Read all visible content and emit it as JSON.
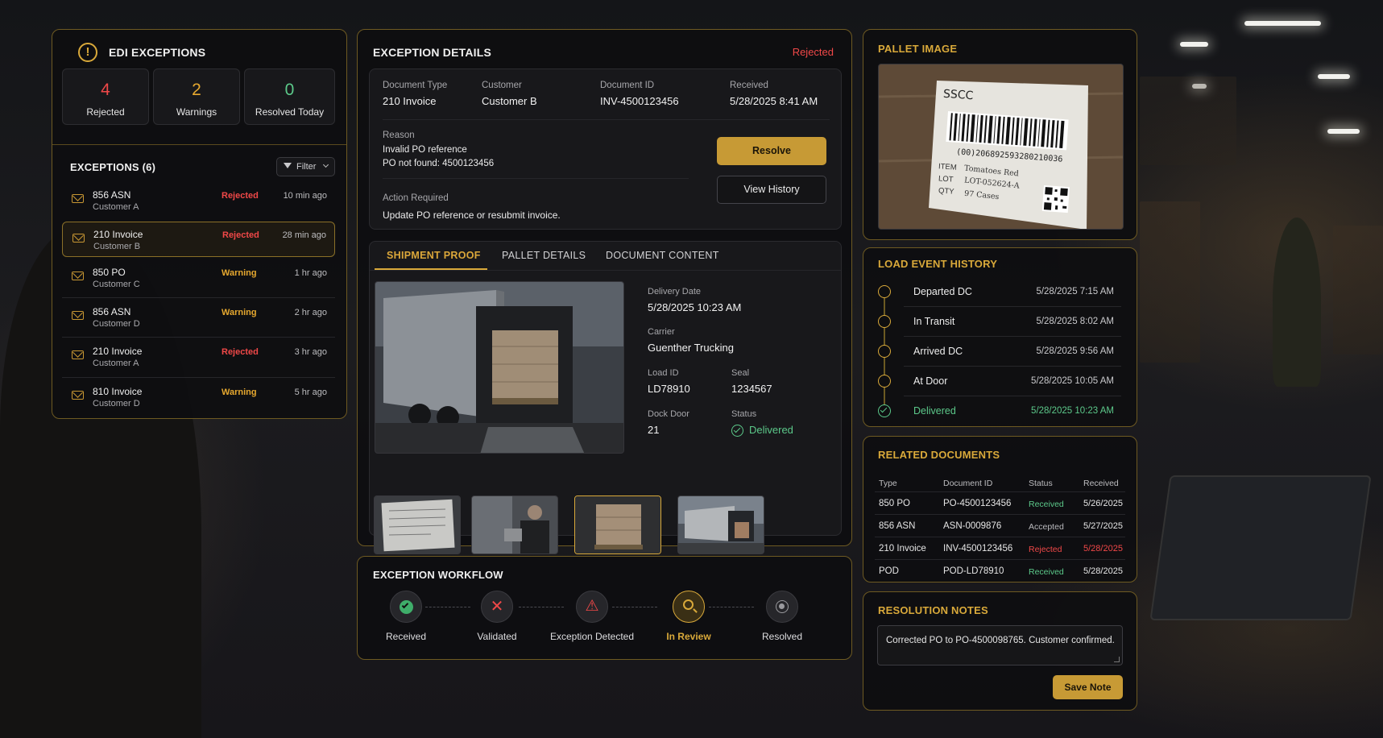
{
  "edi": {
    "title": "EDI EXCEPTIONS",
    "stats": [
      {
        "num": "4",
        "label": "Rejected",
        "color": "#f04848"
      },
      {
        "num": "2",
        "label": "Warnings",
        "color": "#e6a82f"
      },
      {
        "num": "0",
        "label": "Resolved Today",
        "color": "#5cc98a"
      }
    ],
    "list_title": "EXCEPTIONS (6)",
    "filter_label": "Filter",
    "items": [
      {
        "type": "856 ASN",
        "customer": "Customer A",
        "status": "Rejected",
        "time": "10 min ago"
      },
      {
        "type": "210 Invoice",
        "customer": "Customer B",
        "status": "Rejected",
        "time": "28 min ago"
      },
      {
        "type": "850 PO",
        "customer": "Customer C",
        "status": "Warning",
        "time": "1 hr ago"
      },
      {
        "type": "856 ASN",
        "customer": "Customer D",
        "status": "Warning",
        "time": "2 hr ago"
      },
      {
        "type": "210 Invoice",
        "customer": "Customer A",
        "status": "Rejected",
        "time": "3 hr ago"
      },
      {
        "type": "810 Invoice",
        "customer": "Customer D",
        "status": "Warning",
        "time": "5 hr ago"
      }
    ]
  },
  "details": {
    "title": "EXCEPTION DETAILS",
    "status": "Rejected",
    "doc_type_label": "Document Type",
    "doc_type": "210 Invoice",
    "customer_label": "Customer",
    "customer": "Customer B",
    "doc_id_label": "Document ID",
    "doc_id": "INV-4500123456",
    "received_label": "Received",
    "received": "5/28/2025 8:41 AM",
    "reason_label": "Reason",
    "reason_line1": "Invalid PO reference",
    "reason_line2": "PO not found: 4500123456",
    "action_label": "Action Required",
    "action": "Update PO reference or resubmit invoice.",
    "resolve_label": "Resolve",
    "history_label": "View History"
  },
  "tabs": [
    "SHIPMENT PROOF",
    "PALLET DETAILS",
    "DOCUMENT CONTENT"
  ],
  "shipment": {
    "delivery_date_label": "Delivery Date",
    "delivery_date": "5/28/2025 10:23 AM",
    "carrier_label": "Carrier",
    "carrier": "Guenther Trucking",
    "load_id_label": "Load ID",
    "load_id": "LD78910",
    "seal_label": "Seal",
    "seal": "1234567",
    "dock_label": "Dock Door",
    "dock": "21",
    "status_label": "Status",
    "status": "Delivered"
  },
  "pallet": {
    "title": "PALLET IMAGE",
    "label_sscc": "SSCC",
    "label_code": "(00)206892593280210036",
    "label_item_key": "ITEM",
    "label_item": "Tomatoes Red",
    "label_lot_key": "LOT",
    "label_lot": "LOT-052624-A",
    "label_qty_key": "QTY",
    "label_qty": "97 Cases"
  },
  "history": {
    "title": "LOAD EVENT HISTORY",
    "events": [
      {
        "label": "Departed DC",
        "time": "5/28/2025 7:15 AM"
      },
      {
        "label": "In Transit",
        "time": "5/28/2025 8:02 AM"
      },
      {
        "label": "Arrived DC",
        "time": "5/28/2025 9:56 AM"
      },
      {
        "label": "At Door",
        "time": "5/28/2025 10:05 AM"
      },
      {
        "label": "Delivered",
        "time": "5/28/2025 10:23 AM"
      }
    ]
  },
  "related": {
    "title": "RELATED DOCUMENTS",
    "headers": [
      "Type",
      "Document ID",
      "Status",
      "Received"
    ],
    "rows": [
      {
        "type": "850 PO",
        "id": "PO-4500123456",
        "status": "Received",
        "received": "5/26/2025"
      },
      {
        "type": "856 ASN",
        "id": "ASN-0009876",
        "status": "Accepted",
        "received": "5/27/2025"
      },
      {
        "type": "210 Invoice",
        "id": "INV-4500123456",
        "status": "Rejected",
        "received": "5/28/2025"
      },
      {
        "type": "POD",
        "id": "POD-LD78910",
        "status": "Received",
        "received": "5/28/2025"
      }
    ]
  },
  "notes": {
    "title": "RESOLUTION NOTES",
    "value": "Corrected PO to PO-4500098765. Customer confirmed.",
    "save_label": "Save Note"
  },
  "workflow": {
    "title": "EXCEPTION WORKFLOW",
    "steps": [
      "Received",
      "Validated",
      "Exception Detected",
      "In Review",
      "Resolved"
    ]
  },
  "colors": {
    "accent": "#d9a93a",
    "rejected": "#f04848",
    "warning": "#e6a82f",
    "ok": "#5cc98a"
  }
}
